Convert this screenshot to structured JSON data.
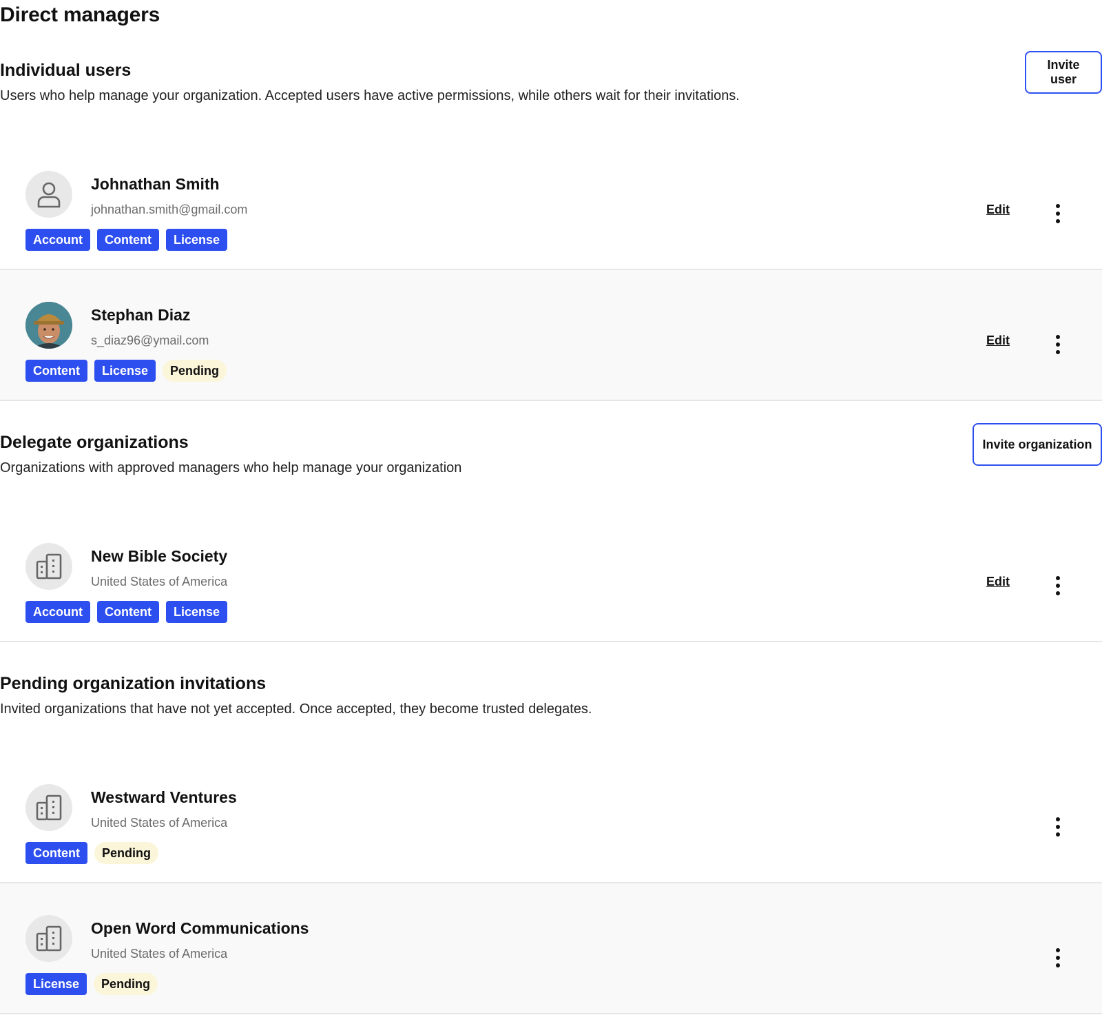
{
  "page": {
    "title": "Direct managers"
  },
  "individual_users": {
    "title": "Individual users",
    "description": "Users who help manage your organization. Accepted users have active permissions, while others wait for their invitations.",
    "invite_label": "Invite user",
    "items": [
      {
        "name": "Johnathan Smith",
        "sub": "johnathan.smith@gmail.com",
        "avatar": "person-icon",
        "tags": [
          "Account",
          "Content",
          "License"
        ],
        "edit_label": "Edit"
      },
      {
        "name": "Stephan Diaz",
        "sub": "s_diaz96@ymail.com",
        "avatar": "user-photo",
        "tags": [
          "Content",
          "License"
        ],
        "status": "Pending",
        "edit_label": "Edit"
      }
    ]
  },
  "delegate_orgs": {
    "title": "Delegate organizations",
    "description": "Organizations with approved managers who help manage your organization",
    "invite_label": "Invite organization",
    "items": [
      {
        "name": "New Bible Society",
        "sub": "United States of America",
        "avatar": "building-icon",
        "tags": [
          "Account",
          "Content",
          "License"
        ],
        "edit_label": "Edit"
      }
    ]
  },
  "pending_orgs": {
    "title": "Pending organization invitations",
    "description": "Invited organizations that have not yet accepted. Once accepted, they become trusted delegates.",
    "items": [
      {
        "name": "Westward Ventures",
        "sub": "United States of America",
        "avatar": "building-icon",
        "tags": [
          "Content"
        ],
        "status": "Pending"
      },
      {
        "name": "Open Word Communications",
        "sub": "United States of America",
        "avatar": "building-icon",
        "tags": [
          "License"
        ],
        "status": "Pending"
      }
    ]
  },
  "colors": {
    "accent": "#2e4ff0",
    "pending_bg": "#fbf6d9",
    "divider": "#e6e6e6",
    "alt_row": "#f9f9f9"
  }
}
